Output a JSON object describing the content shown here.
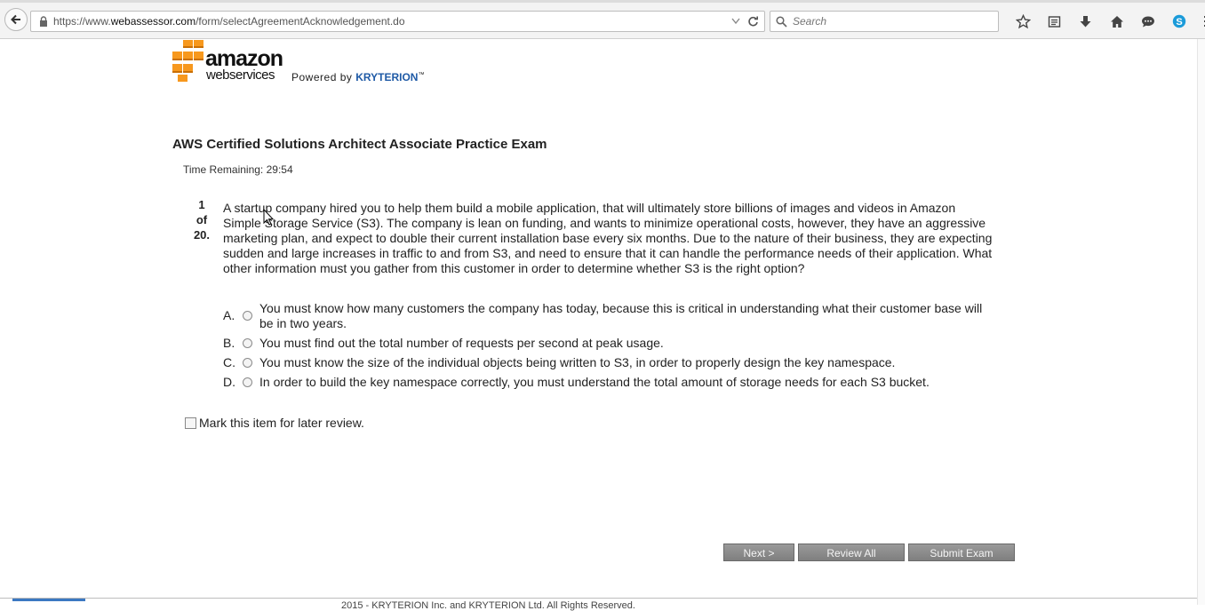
{
  "browser": {
    "url_prefix": "https://www.",
    "url_host": "webassessor.com",
    "url_path": "/form/selectAgreementAcknowledgement.do",
    "search_placeholder": "Search",
    "toolbar_icons": [
      "star-icon",
      "reading-list-icon",
      "download-icon",
      "home-icon",
      "chat-icon",
      "skype-icon",
      "menu-icon"
    ]
  },
  "logo": {
    "brand_top": "amazon",
    "brand_bottom": "webservices",
    "powered_by": "Powered by",
    "partner": "KRYTERION",
    "trademark": "™",
    "brand_color": "#f7981d"
  },
  "exam": {
    "title": "AWS Certified Solutions Architect Associate Practice Exam",
    "time_label": "Time Remaining:",
    "time_value": "29:54",
    "question_number": "1",
    "question_of": "of",
    "question_total": "20.",
    "question_text": "A startup company hired you to help them build a mobile application, that will ultimately store billions of images and videos in Amazon Simple Storage Service (S3). The company is lean on funding, and wants to minimize operational costs, however, they have an aggressive marketing plan, and expect to double their current installation base every six months. Due to the nature of their business, they are expecting sudden and large increases in traffic to and from S3, and need to ensure that it can handle the performance needs of their application. What other information must you gather from this customer in order to determine whether S3 is the right option?",
    "answers": [
      {
        "letter": "A.",
        "text": "You must know how many customers the company has today, because this is critical in understanding what their customer base will be in two years."
      },
      {
        "letter": "B.",
        "text": "You must find out the total number of requests per second at peak usage."
      },
      {
        "letter": "C.",
        "text": "You must know the size of the individual objects being written to S3, in order to properly design the key namespace."
      },
      {
        "letter": "D.",
        "text": "In order to build the key namespace correctly, you must understand the total amount of storage needs for each S3 bucket."
      }
    ],
    "mark_review_label": "Mark this item for later review."
  },
  "buttons": {
    "next": "Next >",
    "review_all": "Review All",
    "submit": "Submit Exam",
    "color": "#8c8c8c"
  },
  "footer": {
    "text": "2015 - KRYTERION Inc. and KRYTERION Ltd. All Rights Reserved."
  }
}
